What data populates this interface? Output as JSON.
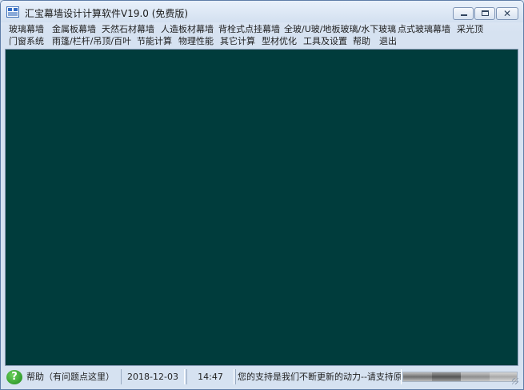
{
  "window": {
    "title": "汇宝幕墙设计计算软件V19.0 (免费版)"
  },
  "menu": {
    "row1": [
      "玻璃幕墙",
      "金属板幕墙",
      "天然石材幕墙",
      "人造板材幕墙",
      "背栓式点挂幕墙",
      "全玻/U玻/地板玻璃/水下玻璃",
      "点式玻璃幕墙",
      "采光顶"
    ],
    "row2": [
      "门窗系统",
      "雨篷/栏杆/吊顶/百叶",
      "节能计算",
      "物理性能",
      "其它计算",
      "型材优化",
      "工具及设置",
      "帮助",
      "退出"
    ]
  },
  "status": {
    "help_icon": "question-icon",
    "help_text": "帮助（有问题点这里）",
    "date": "2018-12-03",
    "time": "14:47",
    "message": "您的支持是我们不断更新的动力--请支持原创"
  },
  "colors": {
    "client_background": "#003c3c",
    "window_frame": "#d6e2f1"
  }
}
